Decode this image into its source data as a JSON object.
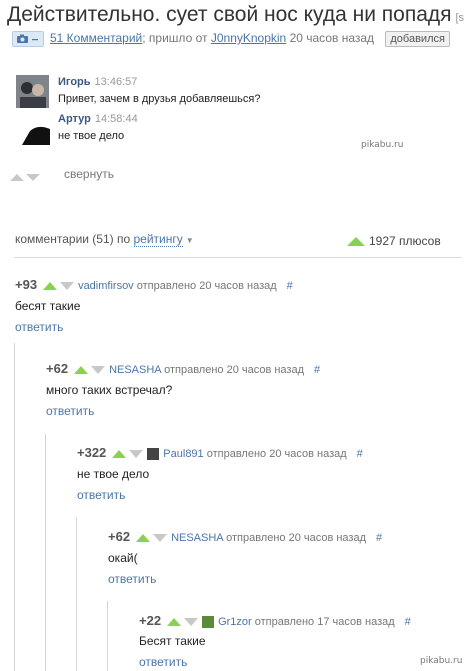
{
  "post": {
    "title": "Действительно. сует свой нос куда ни попадя",
    "source_tag": "[s.pik",
    "comments_link": "51 Комментарий",
    "came_from_prefix": "; пришло от",
    "author": "J0nnyKnopkin",
    "time_ago": "20 часов назад",
    "added_button": "добавился"
  },
  "screenshot": {
    "messages": [
      {
        "name": "Игорь",
        "time": "13:46:57",
        "text": "Привет, зачем в друзья добавляешься?"
      },
      {
        "name": "Артур",
        "time": "14:58:44",
        "text": "не твое дело"
      }
    ],
    "watermark": "pikabu.ru"
  },
  "post_actions": {
    "collapse": "свернуть"
  },
  "comments_header": {
    "prefix": "комментарии (51) по",
    "sort": "рейтингу",
    "total_plus": "1927 плюсов"
  },
  "comments": [
    {
      "rating": "+93",
      "author": "vadimfirsov",
      "sent": "отправлено 20 часов назад",
      "hash": "#",
      "text": "бесят такие",
      "reply": "ответить"
    },
    {
      "rating": "+62",
      "author": "NESASHA",
      "sent": "отправлено 20 часов назад",
      "hash": "#",
      "text": "много таких встречал?",
      "reply": "ответить"
    },
    {
      "rating": "+322",
      "author": "Paul891",
      "sent": "отправлено 20 часов назад",
      "hash": "#",
      "text": "не твое дело",
      "reply": "ответить"
    },
    {
      "rating": "+62",
      "author": "NESASHA",
      "sent": "отправлено 20 часов назад",
      "hash": "#",
      "text": "окай(",
      "reply": "ответить"
    },
    {
      "rating": "+22",
      "author": "Gr1zor",
      "sent": "отправлено 17 часов назад",
      "hash": "#",
      "text": "Бесят такие",
      "reply": "ответить"
    }
  ],
  "footer_watermark": "pikabu.ru",
  "colors": {
    "accent": "#4a76a8",
    "plus_green": "#8bd150"
  }
}
